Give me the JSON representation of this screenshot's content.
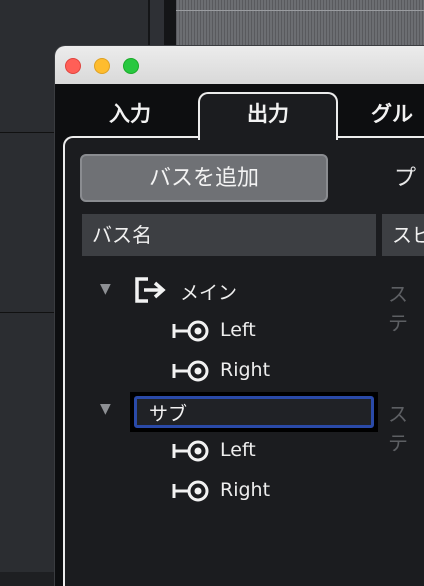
{
  "tabs": {
    "input": "入力",
    "output": "出力",
    "group": "グル"
  },
  "toolbar": {
    "add_bus_label": "バスを追加",
    "preset_label": "プ"
  },
  "columns": {
    "bus_name": "バス名",
    "speaker": "スピ"
  },
  "buses": [
    {
      "name": "メイン",
      "config": "ステ",
      "ports": [
        "Left",
        "Right"
      ]
    },
    {
      "name": "サブ",
      "config": "ステ",
      "ports": [
        "Left",
        "Right"
      ]
    }
  ],
  "colors": {
    "edit_focus": "#2a4aa8",
    "button_bg": "#6f7175",
    "header_bg": "#3d3f43"
  },
  "icons": {
    "output_bus": "output-bus-icon",
    "port": "port-connector-icon",
    "expand": "disclosure-triangle-icon"
  }
}
